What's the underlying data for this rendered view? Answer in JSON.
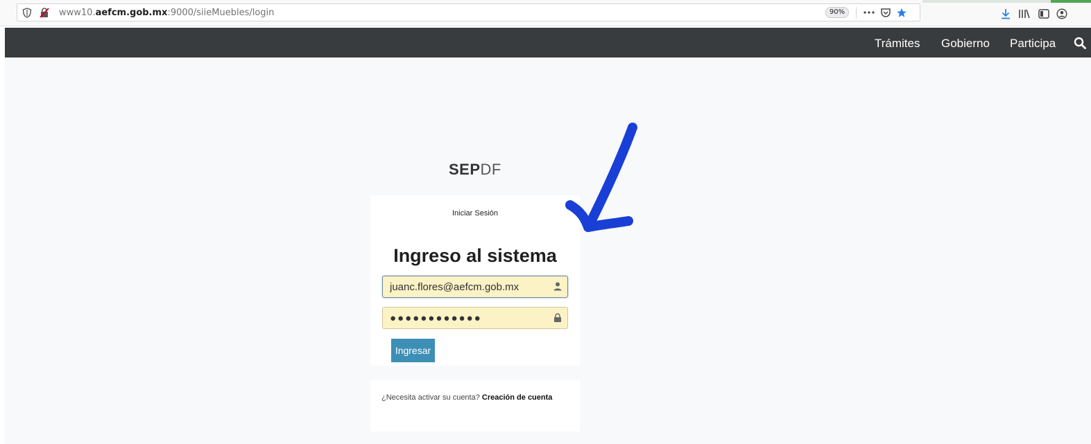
{
  "browser": {
    "url_prefix": "www10.",
    "url_domain": "aefcm.gob.mx",
    "url_rest": ":9000/siieMuebles/login",
    "zoom": "90%",
    "icons": [
      "shield-icon",
      "insecure-lock-icon",
      "page-actions-icon",
      "pocket-icon",
      "bookmark-star-icon",
      "download-icon",
      "library-icon",
      "sidebar-icon",
      "account-icon"
    ]
  },
  "nav": {
    "links": [
      "Trámites",
      "Gobierno",
      "Participa"
    ],
    "search_icon": "search-icon"
  },
  "logo": {
    "strong": "SEP",
    "light": "DF"
  },
  "login": {
    "subtitle": "Iniciar Sesión",
    "title": "Ingreso al sistema",
    "email_value": "juanc.flores@aefcm.gob.mx",
    "password_masked": "●●●●●●●●●●●●",
    "submit_label": "Ingresar"
  },
  "signup": {
    "question": "¿Necesita activar su cuenta?",
    "link": "Creación de cuenta"
  },
  "colors": {
    "nav_bg": "#393c3e",
    "page_bg": "#f7f9fb",
    "field_bg": "#fbf2c6",
    "button_bg": "#3d8fb6",
    "annotation_arrow": "#1a3fd6"
  }
}
